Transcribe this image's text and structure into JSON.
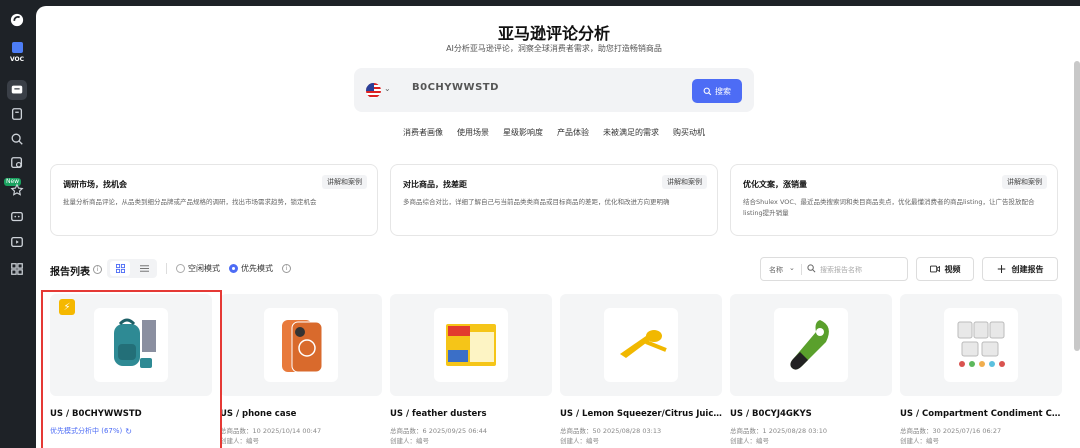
{
  "sidebar": {
    "voc_label": "VOC",
    "new_badge": "New",
    "items": [
      {
        "icon": "logo-icon"
      },
      {
        "icon": "chat-icon"
      },
      {
        "icon": "document-icon"
      },
      {
        "icon": "search-analysis-icon"
      },
      {
        "icon": "image-search-icon"
      },
      {
        "icon": "star-icon"
      },
      {
        "icon": "message-icon"
      },
      {
        "icon": "play-icon"
      },
      {
        "icon": "grid-icon"
      }
    ]
  },
  "header": {
    "title": "亚马逊评论分析",
    "subtitle": "AI分析亚马逊评论，洞察全球消费者需求，助您打造畅销商品"
  },
  "search": {
    "country": "US",
    "value": "B0CHYWWSTD",
    "button": "搜索"
  },
  "tags": [
    "消费者画像",
    "使用场景",
    "星级影响度",
    "产品体验",
    "未被满足的需求",
    "购买动机"
  ],
  "cards": [
    {
      "title": "调研市场，找机会",
      "button": "讲解和案例",
      "desc": "批量分析商品评论，从品类到细分品牌或产品规格的调研，找出市场需求趋势，锁定机会"
    },
    {
      "title": "对比商品，找差距",
      "button": "讲解和案例",
      "desc": "多商品综合对比，详细了解自己与当前品类类商品或目标商品的差距，优化和改进方向更明确"
    },
    {
      "title": "优化文案，涨销量",
      "button": "讲解和案例",
      "desc": "结合Shulex VOC、最近品类搜索词和类目商品卖点，优化最懂消费者的商品listing，让广告投放配合listing提升销量"
    }
  ],
  "list": {
    "heading": "报告列表",
    "mode_idle": "空闲模式",
    "mode_priority": "优先模式",
    "sort_label": "名称",
    "search_placeholder": "搜索报告名称",
    "video_button": "视频",
    "create_button": "创建报告"
  },
  "reports": [
    {
      "title": "US / B0CHYWWSTD",
      "status": "优先模式分析中 (67%)",
      "progress": 0.67,
      "product": "backpack"
    },
    {
      "title": "US / phone case",
      "meta": "总商品数：10  2025/10/14 00:47",
      "creator": "创建人：编号",
      "product": "phone-case"
    },
    {
      "title": "US / feather dusters",
      "meta": "总商品数：6  2025/09/25 06:44",
      "creator": "创建人：编号",
      "product": "duster"
    },
    {
      "title": "US / Lemon Squeezer/Citrus Juicer",
      "meta": "总商品数：50  2025/08/28 03:13",
      "creator": "创建人：编号",
      "product": "lemon-squeezer"
    },
    {
      "title": "US / B0CYJ4GKYS",
      "meta": "总商品数：1  2025/08/28 03:10",
      "creator": "创建人：编号",
      "product": "avocado-slicer"
    },
    {
      "title": "US / Compartment Condiment Co...",
      "meta": "总商品数：30  2025/07/16 06:27",
      "creator": "创建人：编号",
      "product": "condiment-containers"
    }
  ],
  "colors": {
    "accent": "#4d6cf5",
    "highlight": "#e53935",
    "sidebar": "#1e2227"
  }
}
